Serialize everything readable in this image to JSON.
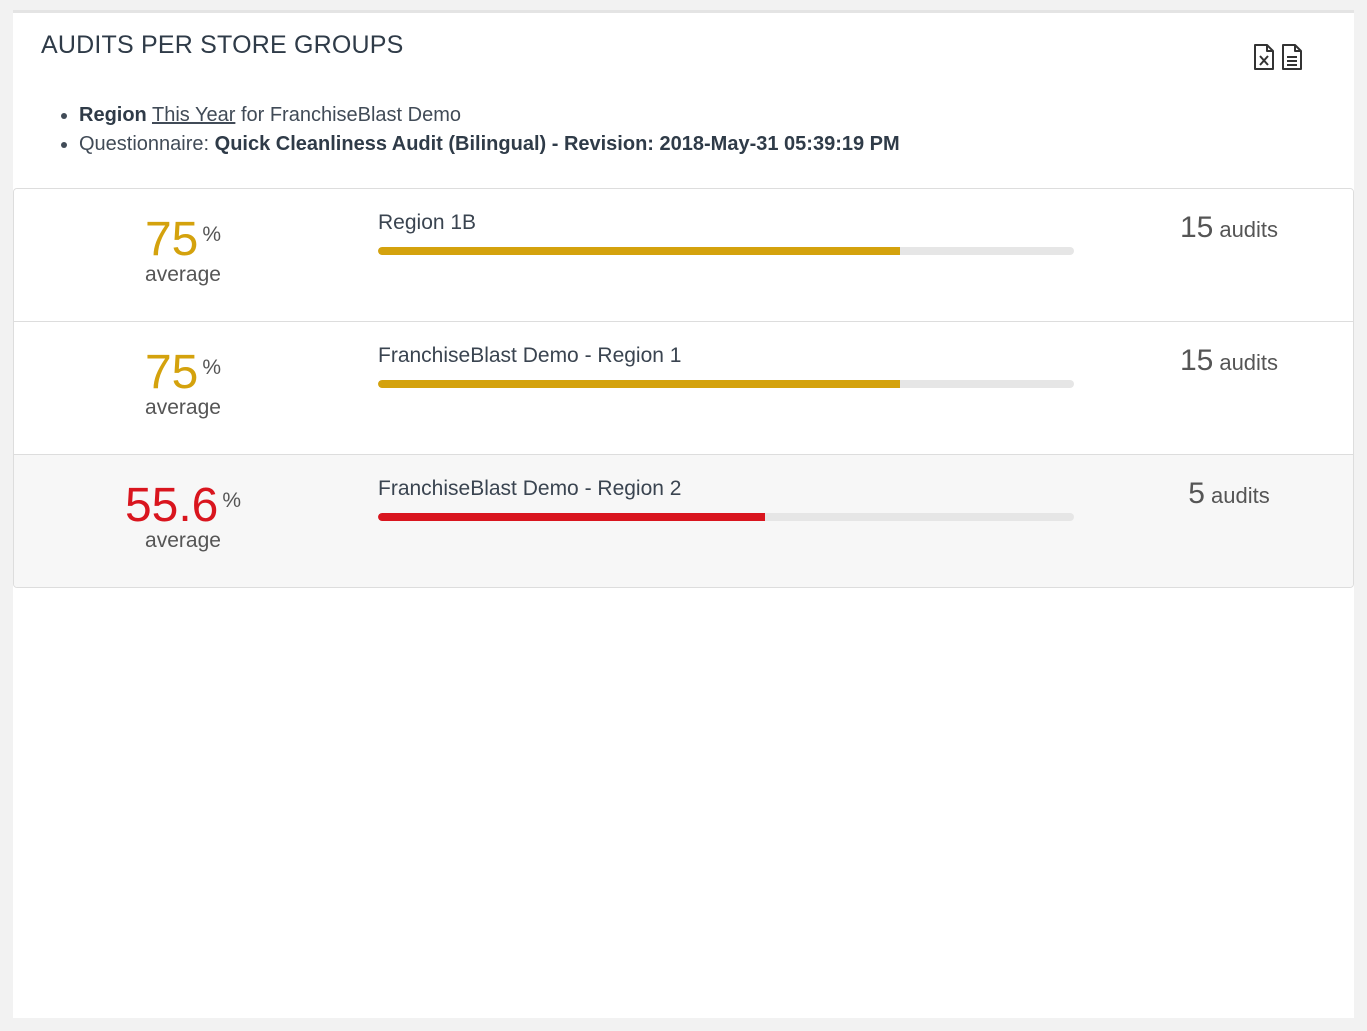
{
  "panel": {
    "title": "AUDITS PER STORE GROUPS",
    "export_excel_icon": "file-excel-icon",
    "export_doc_icon": "file-text-icon"
  },
  "meta": {
    "group_type": "Region",
    "period": "This Year",
    "for_text": "for FranchiseBlast Demo",
    "questionnaire_label": "Questionnaire:",
    "questionnaire_name": "Quick Cleanliness Audit (Bilingual) - Revision: 2018-May-31 05:39:19 PM"
  },
  "rows": [
    {
      "score": "75",
      "unit": "%",
      "caption": "average",
      "group": "Region 1B",
      "progress": 0.75,
      "count": "15",
      "count_label": "audits",
      "status": "warning"
    },
    {
      "score": "75",
      "unit": "%",
      "caption": "average",
      "group": "FranchiseBlast Demo - Region 1",
      "progress": 0.75,
      "count": "15",
      "count_label": "audits",
      "status": "warning"
    },
    {
      "score": "55.6",
      "unit": "%",
      "caption": "average",
      "group": "FranchiseBlast Demo - Region 2",
      "progress": 0.556,
      "count": "5",
      "count_label": "audits",
      "status": "bad"
    }
  ],
  "colors": {
    "warning": "#d4a20d",
    "bad": "#d9151e",
    "bar_track": "#e6e6e6"
  }
}
